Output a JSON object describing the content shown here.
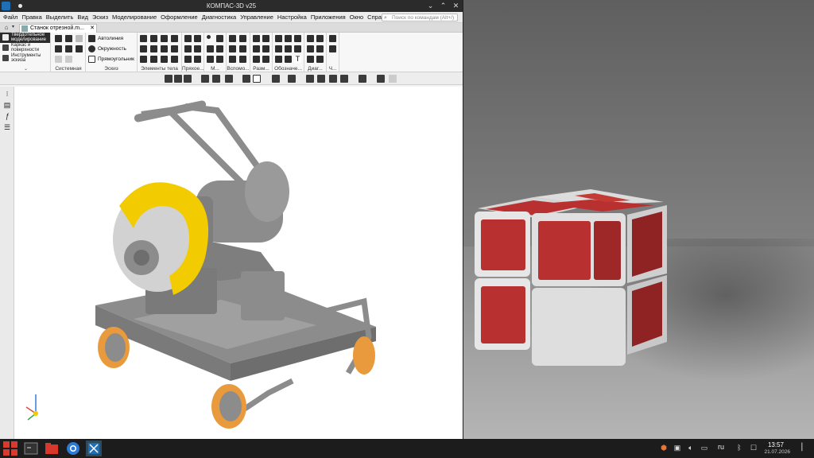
{
  "window": {
    "title": "КОМПАС-3D v25"
  },
  "menu": {
    "items": [
      "Файл",
      "Правка",
      "Выделить",
      "Вид",
      "Эскиз",
      "Моделирование",
      "Оформление",
      "Диагностика",
      "Управление",
      "Настройка",
      "Приложения",
      "Окно",
      "Справка"
    ],
    "search_placeholder": "Поиск по командам (Alt+/)"
  },
  "document_tab": {
    "label": "Станок отрезной.m..."
  },
  "ribbon": {
    "left_panel": [
      "Твердотельное моделирование",
      "Каркас и поверхности",
      "Инструменты эскиза"
    ],
    "sketch_tools": [
      "Автолиния",
      "Окружность",
      "Прямоугольник"
    ],
    "groups": [
      "Системная",
      "Эскиз",
      "Элементы тела",
      "Пряхое...",
      "М...",
      "Вспомо...",
      "Разм...",
      "Обозначе...",
      "Диаг...",
      "Ч..."
    ]
  },
  "taskbar": {
    "tray_lang": "ru",
    "clock_time": "13:57",
    "clock_date": "21.07.2026"
  },
  "colors": {
    "saw_guard": "#f2cc00",
    "machine_body": "#8c8c8c",
    "wheel_rim": "#e89a3c",
    "cube_red": "#b8302f",
    "cube_white": "#d8d8d8"
  }
}
